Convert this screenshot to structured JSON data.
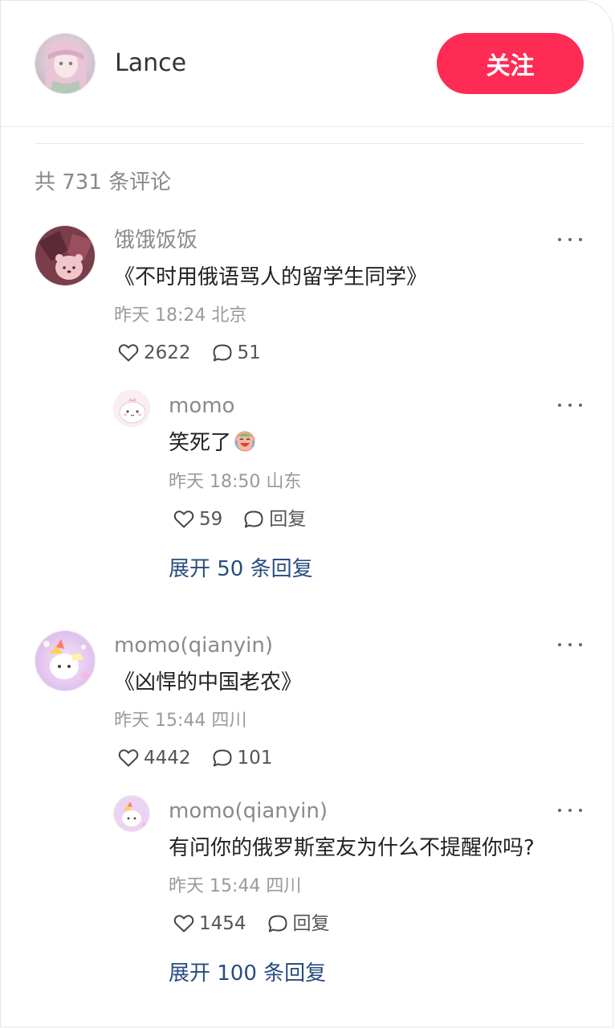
{
  "header": {
    "author_name": "Lance",
    "follow_label": "关注"
  },
  "comments_header": {
    "count_text": "共 731 条评论"
  },
  "colors": {
    "accent": "#fe2c55",
    "expand_link": "#2a4d80"
  },
  "comments": [
    {
      "username": "饿饿饭饭",
      "text": "《不时用俄语骂人的留学生同学》",
      "meta": "昨天 18:24 北京",
      "likes": "2622",
      "replies": "51",
      "more_icon": "ellipsis-icon",
      "reply": {
        "username": "momo",
        "text": "笑死了",
        "emoji": "crying-laughing-face-icon",
        "meta": "昨天 18:50 山东",
        "likes": "59",
        "reply_label": "回复"
      },
      "expand_text": "展开 50 条回复"
    },
    {
      "username": "momo(qianyin)",
      "text": "《凶悍的中国老农》",
      "meta": "昨天 15:44 四川",
      "likes": "4442",
      "replies": "101",
      "more_icon": "ellipsis-icon",
      "reply": {
        "username": "momo(qianyin)",
        "text": "有问你的俄罗斯室友为什么不提醒你吗?",
        "meta": "昨天 15:44 四川",
        "likes": "1454",
        "reply_label": "回复"
      },
      "expand_text": "展开 100 条回复"
    }
  ]
}
